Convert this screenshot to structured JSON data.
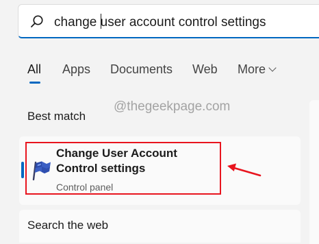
{
  "search": {
    "query_before_caret": "change ",
    "query_after_caret": "user account control settings"
  },
  "tabs": [
    {
      "label": "All",
      "active": true
    },
    {
      "label": "Apps"
    },
    {
      "label": "Documents"
    },
    {
      "label": "Web"
    },
    {
      "label": "More"
    }
  ],
  "best_match": {
    "label": "Best match",
    "result": {
      "title": "Change User Account Control settings",
      "subtitle": "Control panel",
      "icon": "uac-flag-icon"
    }
  },
  "watermark": "@thegeekpage.com",
  "search_web": {
    "label": "Search the web"
  },
  "colors": {
    "accent": "#0067c0",
    "highlight": "#e8141e",
    "background": "#f3f3f3",
    "card": "#fafafa"
  }
}
